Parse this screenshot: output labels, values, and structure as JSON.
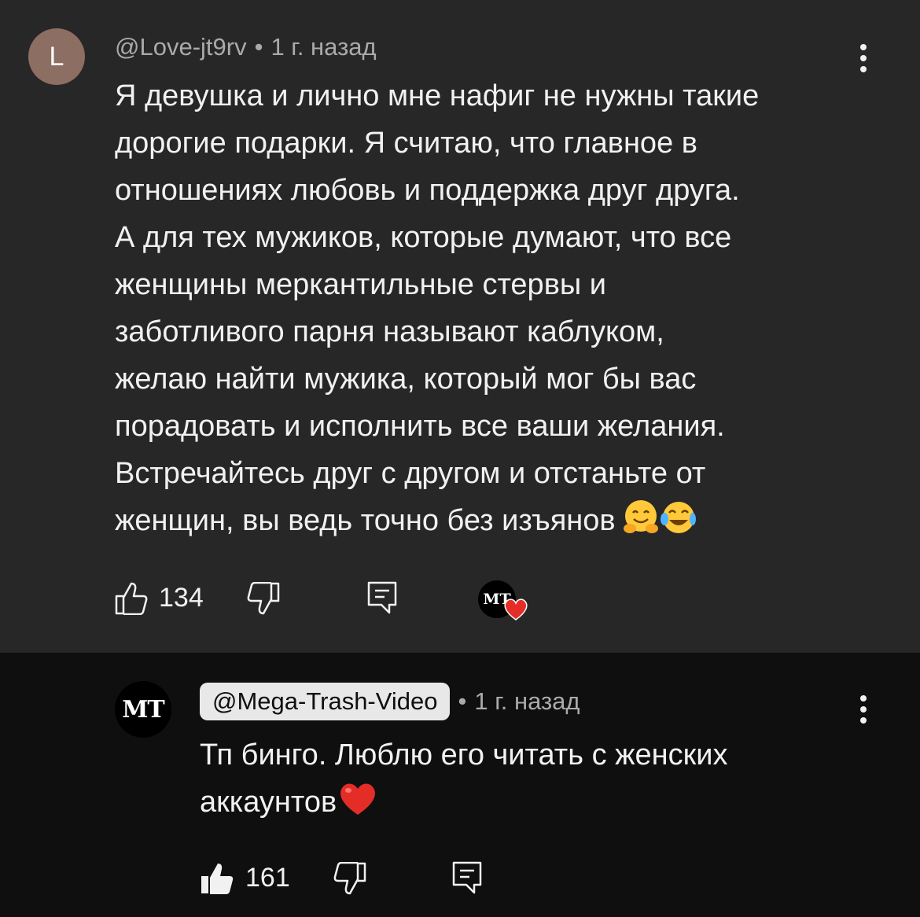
{
  "top_comment": {
    "avatar_letter": "L",
    "author": "@Love-jt9rv",
    "separator": "•",
    "time": "1 г. назад",
    "lines": [
      "Я девушка и лично мне нафиг не нужны такие",
      "дорогие подарки. Я считаю, что главное в",
      "отношениях любовь и поддержка друг друга.",
      "А для тех мужиков, которые думают, что все",
      "женщины меркантильные стервы и",
      "заботливого парня называют каблуком,",
      "желаю найти мужика, который мог бы вас",
      "порадовать и исполнить все ваши желания.",
      "Встречайтесь друг с другом и отстаньте от",
      "женщин, вы ведь точно без изъянов"
    ],
    "emojis": [
      "hugging-face-emoji",
      "tears-of-joy-emoji"
    ],
    "likes": "134",
    "hearted_by": "MT"
  },
  "reply": {
    "avatar_text": "MT",
    "author": "@Mega-Trash-Video",
    "separator": "•",
    "time": "1 г. назад",
    "lines": [
      "Тп бинго. Люблю его читать с женских",
      "аккаунтов"
    ],
    "emoji": "red-heart-emoji",
    "likes": "161"
  },
  "colors": {
    "top_bg": "#272727",
    "reply_bg": "#0f0f0f",
    "avatar_l": "#8d6e63",
    "heart": "#e52d27"
  }
}
